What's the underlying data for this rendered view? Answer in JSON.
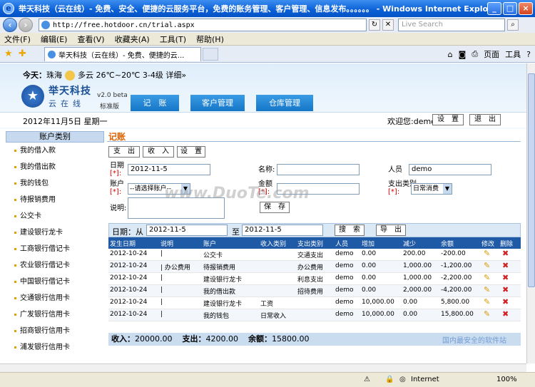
{
  "window": {
    "title": "举天科技（云在线）- 免费、安全、便捷的云服务平台，免费的账务管理、客户管理、信息发布。。。。。。 - Windows Internet Explorer",
    "minimize": "_",
    "maximize": "□",
    "close": "×"
  },
  "address": {
    "url": "http://free.hotdoor.cn/trial.aspx",
    "search_placeholder": "Live Search"
  },
  "menu": [
    "文件(F)",
    "编辑(E)",
    "查看(V)",
    "收藏夹(A)",
    "工具(T)",
    "帮助(H)"
  ],
  "tab": {
    "label": "举天科技（云在线）- 免费、便捷的云..."
  },
  "commands": {
    "page": "页面",
    "tools": "工具"
  },
  "header": {
    "weather_today": "今天：",
    "weather_city": "珠海",
    "weather_desc": "多云 26℃~20℃ 3-4级",
    "weather_detail": "详细»",
    "brand_name": "举天科技",
    "brand_sub": "云在线",
    "version": "v2.0 beta",
    "edition": "标准版",
    "nav": [
      "记　账",
      "客户管理",
      "仓库管理"
    ],
    "date": "2012年11月5日 星期一",
    "welcome": "欢迎您:demo",
    "settings_btn": "设　置",
    "logout_btn": "退　出"
  },
  "sidebar": {
    "header": "账户类别",
    "items": [
      "我的借入款",
      "我的借出款",
      "我的钱包",
      "待报销费用",
      "公交卡",
      "建设银行龙卡",
      "工商银行借记卡",
      "农业银行借记卡",
      "中国银行借记卡",
      "交通银行信用卡",
      "广发银行信用卡",
      "招商银行信用卡",
      "浦发银行信用卡"
    ]
  },
  "main": {
    "title": "记账",
    "tabs": [
      "支　出",
      "收　入",
      "设　置"
    ],
    "form": {
      "date_label": "日期",
      "date_value": "2012-11-5",
      "name_label": "名称:",
      "name_value": "",
      "person_label": "人员",
      "person_value": "demo",
      "account_label": "账户",
      "account_value": "--请选择账户--",
      "amount_label": "金额",
      "amount_value": "",
      "category_label": "支出类别",
      "category_value": "日常消费",
      "note_label": "说明:",
      "note_value": "",
      "save_btn": "保　存",
      "required_mark": "[*]:"
    },
    "filter": {
      "label": "日期：从",
      "from": "2012-11-5",
      "to_label": "至",
      "to": "2012-11-5",
      "search_btn": "搜　索",
      "export_btn": "导　出"
    },
    "table": {
      "headers": [
        "发生日期",
        "说明",
        "账户",
        "收入类别",
        "支出类别",
        "人员",
        "增加",
        "减少",
        "余额",
        "修改",
        "删除"
      ],
      "rows": [
        [
          "2012-10-24",
          "|",
          "公交卡",
          "",
          "交通支出",
          "demo",
          "0.00",
          "200.00",
          "-200.00"
        ],
        [
          "2012-10-24",
          "| 办公费用",
          "待报销费用",
          "",
          "办公费用",
          "demo",
          "0.00",
          "1,000.00",
          "-1,200.00"
        ],
        [
          "2012-10-24",
          "|",
          "建设银行龙卡",
          "",
          "利息支出",
          "demo",
          "0.00",
          "1,000.00",
          "-2,200.00"
        ],
        [
          "2012-10-24",
          "|",
          "我的借出款",
          "",
          "招待费用",
          "demo",
          "0.00",
          "2,000.00",
          "-4,200.00"
        ],
        [
          "2012-10-24",
          "|",
          "建设银行龙卡",
          "工资",
          "",
          "demo",
          "10,000.00",
          "0.00",
          "5,800.00"
        ],
        [
          "2012-10-24",
          "|",
          "我的钱包",
          "日常收入",
          "",
          "demo",
          "10,000.00",
          "0.00",
          "15,800.00"
        ]
      ]
    },
    "summary": {
      "income_label": "收入：",
      "income": "20000.00",
      "expense_label": "支出：",
      "expense": "4200.00",
      "balance_label": "余额：",
      "balance": "15800.00"
    }
  },
  "watermark": {
    "text": "www.DuoTe.com",
    "corner": "国内最安全的软件站"
  },
  "status": {
    "zone": "Internet",
    "zoom": "100%"
  }
}
